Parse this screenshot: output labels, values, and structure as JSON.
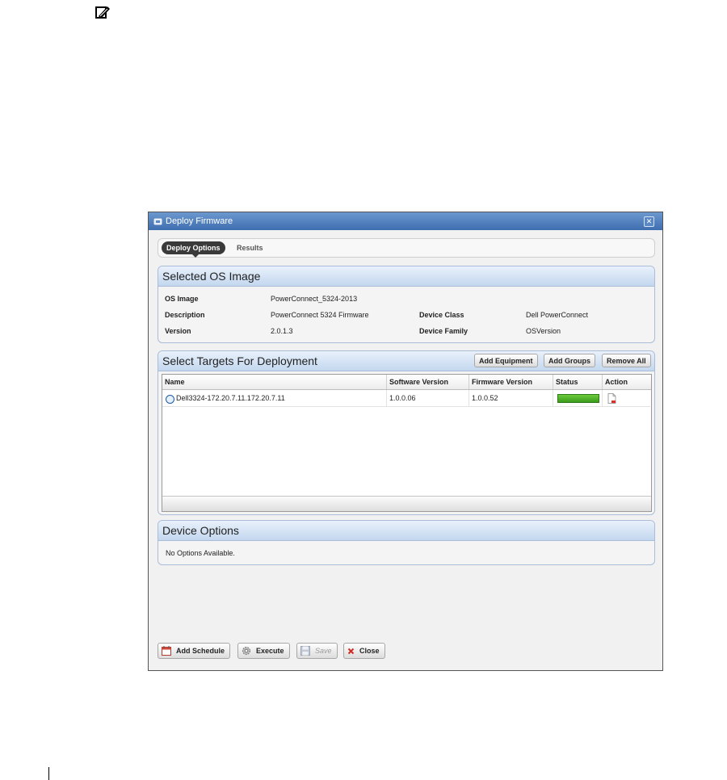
{
  "window": {
    "title": "Deploy Firmware"
  },
  "tabs": [
    {
      "label": "Deploy Options"
    },
    {
      "label": "Results"
    }
  ],
  "os_image_panel": {
    "title": "Selected OS Image",
    "fields": {
      "os_image": {
        "label": "OS Image",
        "value": "PowerConnect_5324-2013"
      },
      "description": {
        "label": "Description",
        "value": "PowerConnect 5324 Firmware"
      },
      "version": {
        "label": "Version",
        "value": "2.0.1.3"
      },
      "device_class": {
        "label": "Device Class",
        "value": "Dell PowerConnect"
      },
      "device_family": {
        "label": "Device Family",
        "value": "OSVersion"
      }
    }
  },
  "targets_panel": {
    "title": "Select Targets For Deployment",
    "buttons": {
      "add_equipment": "Add Equipment",
      "add_groups": "Add Groups",
      "remove_all": "Remove All"
    },
    "columns": [
      "Name",
      "Software Version",
      "Firmware Version",
      "Status",
      "Action"
    ],
    "rows": [
      {
        "name": "Dell3324-172.20.7.11.172.20.7.11",
        "software_version": "1.0.0.06",
        "firmware_version": "1.0.0.52",
        "status_progress": 1.0,
        "action_icon": "remove-document-icon"
      }
    ]
  },
  "device_options_panel": {
    "title": "Device Options",
    "message": "No Options Available."
  },
  "footer": {
    "add_schedule": "Add Schedule",
    "execute": "Execute",
    "save": "Save",
    "close": "Close"
  },
  "colors": {
    "title_bar": "#4a7bbd",
    "status_fill": "#4fb227",
    "panel_header": "#c3d7ef"
  }
}
